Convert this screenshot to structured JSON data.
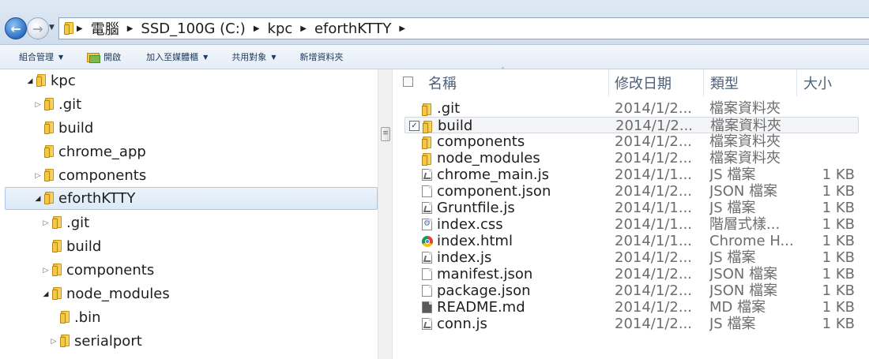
{
  "address_bar": {
    "crumbs": [
      "電腦",
      "SSD_100G (C:)",
      "kpc",
      "eforthKTTY"
    ]
  },
  "toolbar": {
    "organize": "組合管理",
    "open": "開啟",
    "add_to_library": "加入至媒體櫃",
    "share_with": "共用對象",
    "new_folder": "新增資料夾"
  },
  "tree": {
    "items": [
      {
        "label": "kpc",
        "expanded": true
      },
      {
        "label": ".git",
        "expanded": false
      },
      {
        "label": "build"
      },
      {
        "label": "chrome_app"
      },
      {
        "label": "components",
        "expanded": false
      },
      {
        "label": "eforthKTTY",
        "expanded": true,
        "selected": true
      },
      {
        "label": ".git",
        "expanded": false
      },
      {
        "label": "build"
      },
      {
        "label": "components",
        "expanded": false
      },
      {
        "label": "node_modules",
        "expanded": true
      },
      {
        "label": ".bin"
      },
      {
        "label": "serialport",
        "expanded": false
      }
    ]
  },
  "list": {
    "headers": {
      "name": "名稱",
      "date": "修改日期",
      "type": "類型",
      "size": "大小"
    },
    "rows": [
      {
        "icon": "folder-icon",
        "name": ".git",
        "date": "2014/1/2...",
        "type": "檔案資料夾",
        "size": ""
      },
      {
        "icon": "folder-icon",
        "name": "build",
        "date": "2014/1/2...",
        "type": "檔案資料夾",
        "size": "",
        "checked": true
      },
      {
        "icon": "folder-icon",
        "name": "components",
        "date": "2014/1/2...",
        "type": "檔案資料夾",
        "size": ""
      },
      {
        "icon": "folder-icon",
        "name": "node_modules",
        "date": "2014/1/2...",
        "type": "檔案資料夾",
        "size": ""
      },
      {
        "icon": "js-file-icon",
        "name": "chrome_main.js",
        "date": "2014/1/1...",
        "type": "JS 檔案",
        "size": "1 KB"
      },
      {
        "icon": "file-icon",
        "name": "component.json",
        "date": "2014/1/2...",
        "type": "JSON 檔案",
        "size": "1 KB"
      },
      {
        "icon": "js-file-icon",
        "name": "Gruntfile.js",
        "date": "2014/1/1...",
        "type": "JS 檔案",
        "size": "1 KB"
      },
      {
        "icon": "css-file-icon",
        "name": "index.css",
        "date": "2014/1/1...",
        "type": "階層式樣...",
        "size": "1 KB"
      },
      {
        "icon": "chrome-icon",
        "name": "index.html",
        "date": "2014/1/1...",
        "type": "Chrome H...",
        "size": "1 KB"
      },
      {
        "icon": "js-file-icon",
        "name": "index.js",
        "date": "2014/1/2...",
        "type": "JS 檔案",
        "size": "1 KB"
      },
      {
        "icon": "file-icon",
        "name": "manifest.json",
        "date": "2014/1/2...",
        "type": "JSON 檔案",
        "size": "1 KB"
      },
      {
        "icon": "file-icon",
        "name": "package.json",
        "date": "2014/1/2...",
        "type": "JSON 檔案",
        "size": "1 KB"
      },
      {
        "icon": "md-file-icon",
        "name": "README.md",
        "date": "2014/1/2...",
        "type": "MD 檔案",
        "size": "1 KB"
      },
      {
        "icon": "js-file-icon",
        "name": "conn.js",
        "date": "2014/1/2...",
        "type": "JS 檔案",
        "size": "1 KB"
      }
    ]
  }
}
